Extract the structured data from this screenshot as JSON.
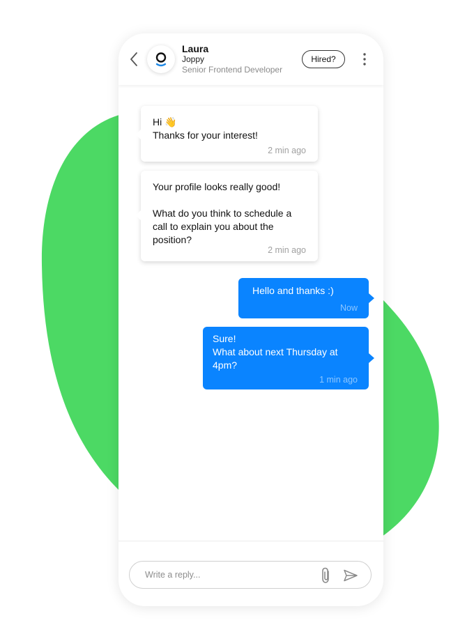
{
  "header": {
    "name": "Laura",
    "company": "Joppy",
    "role": "Senior Frontend Developer",
    "hired_label": "Hired?",
    "back_icon": "chevron-left-icon",
    "more_icon": "more-vertical-icon",
    "avatar_logo": "joppy-logo"
  },
  "messages": [
    {
      "direction": "incoming",
      "text": "Hi 👋\nThanks for your interest!",
      "time": "2 min ago"
    },
    {
      "direction": "incoming",
      "text": "Your profile looks really good!\n\nWhat do you think to schedule a\ncall to explain you about the\nposition?",
      "time": "2 min ago"
    },
    {
      "direction": "outgoing",
      "text": "Hello and thanks :)",
      "time": "Now"
    },
    {
      "direction": "outgoing",
      "text": "Sure!\nWhat about next Thursday at\n4pm?",
      "time": "1 min ago"
    }
  ],
  "composer": {
    "placeholder": "Write a reply...",
    "value": "",
    "attach_icon": "paperclip-icon",
    "send_icon": "send-icon"
  },
  "colors": {
    "blob": "#4cd964",
    "outgoing_bubble": "#0a84ff",
    "avatar_accent": "#1e88e5"
  }
}
